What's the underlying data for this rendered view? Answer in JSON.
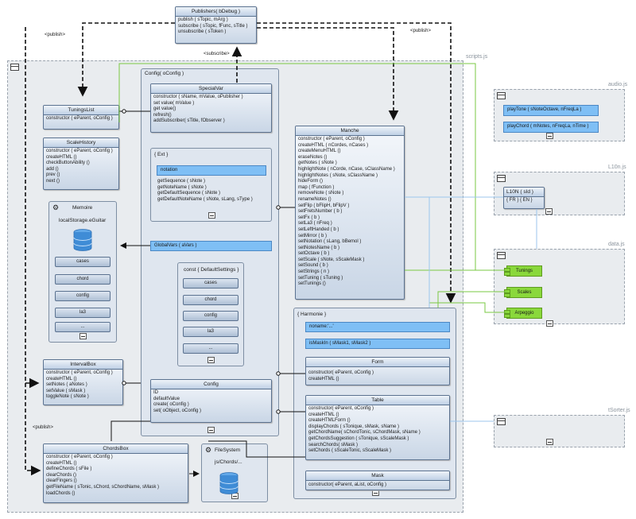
{
  "packages": {
    "scripts": {
      "label": "scripts.js"
    },
    "audio": {
      "label": "audio.js"
    },
    "l10n": {
      "label": "L10n.js"
    },
    "data": {
      "label": "data.js"
    },
    "isorter": {
      "label": "tSorter.js"
    }
  },
  "publishers": {
    "title": "Publishers( bDebug )",
    "methods": [
      "publish ( sTopic, mArg )",
      "subscribe ( sTopic, fFunc, sTitle )",
      "unsubscribe ( sToken )"
    ]
  },
  "connector_labels": {
    "publish_left": "<publish>",
    "subscribe": "<subscribe>",
    "publish_right": "<publish>",
    "publish_bottom": "<publish>"
  },
  "config_frame": {
    "title": "Config( oConfig )"
  },
  "special_var": {
    "title": "SpecialVar",
    "methods": [
      "constructor ( sName, mValue, oPublisher )",
      "set value( mValue )",
      "get value()",
      "refresh()",
      "addSubscriber( sTitle, fObserver )"
    ]
  },
  "ext_frame": {
    "title": "{ Ext }",
    "attribute": "notation",
    "methods": [
      "getSequence ( sNote )",
      "getNoteName ( sNote )",
      "getDefaultSequence ( sNote )",
      "getDefaultNoteName ( sNote, sLang, sType )"
    ]
  },
  "global_vars": {
    "label": "GlobalVars ( aVars )"
  },
  "default_settings": {
    "title": "const { DefaultSettings }",
    "items": [
      "cases",
      "chord",
      "config",
      "la3",
      "..."
    ]
  },
  "config_class": {
    "title": "Config",
    "members": [
      "ID",
      "defaultValue",
      "create( oConfig )",
      "set( oObject, oConfig )"
    ]
  },
  "tunings_list": {
    "title": "TuningsList",
    "methods": [
      "constructor ( eParent, oConfig )"
    ]
  },
  "scale_history": {
    "title": "ScaleHistory",
    "methods": [
      "constructor ( eParent, oConfig )",
      "createHTML ()",
      "checkButtonAbility ()",
      "add ()",
      "prev ()",
      "next ()"
    ]
  },
  "memoire": {
    "title": "Memoire",
    "subtitle": "localStorage.eGuitar",
    "items": [
      "cases",
      "chord",
      "config",
      "la3",
      "..."
    ]
  },
  "interval_box": {
    "title": "IntervalBox",
    "methods": [
      "constructor ( eParent, oConfig )",
      "createHTML ()",
      "setNotes ( aNotes )",
      "setValue ( sMask )",
      "toggleNote ( sNote )"
    ]
  },
  "chords_box": {
    "title": "ChordsBox",
    "methods": [
      "constructor ( eParent, oConfig )",
      "createHTML ()",
      "defineChords ( sFile )",
      "clearChords ()",
      "clearFingers ()",
      "getFileName ( sTonic, sChord, sChordName, sMask )",
      "loadChords ()"
    ]
  },
  "file_system": {
    "title": "FileSystem",
    "subtitle": "js/Chords/..."
  },
  "manche": {
    "title": "Manche",
    "methods": [
      "constructor ( eParent, oConfig )",
      "createHTML ( nCordes, nCases )",
      "createMenuHTML ()",
      "eraseNotes ()",
      "getNotes ( sNote )",
      "highlightNote ( nCorde, nCase, sClassName )",
      "highlightNotes ( sNote, sClassName )",
      "hideForm ()",
      "map ( fFunction )",
      "removeNote ( sNote )",
      "renameNotes ()",
      "setFlip ( bFlipH, bFlipV )",
      "setFretsNumber ( b )",
      "setFx ( b )",
      "setLa3 ( nFreq )",
      "setLeftHanded ( b )",
      "setMirror ( b )",
      "setNotation ( sLang, bBemol )",
      "setNotesName ( b )",
      "setOctave ( b )",
      "setScale ( sNote, sScaleMask )",
      "setSound ( b )",
      "setStrings ( n )",
      "setTuning ( sTuning )",
      "setTunings ()"
    ]
  },
  "harmonie": {
    "title": "{ Harmonie }",
    "attr1": "noname:'...'",
    "attr2": "isMaskIn ( sMask1, sMask2 )"
  },
  "form": {
    "title": "Form",
    "methods": [
      "constructor( eParent, oConfig )",
      "createHTML ()"
    ]
  },
  "table": {
    "title": "Table",
    "methods": [
      "constructor( eParent, oConfig )",
      "createHTML ()",
      "createHTMLForm ()",
      "displayChords ( sTonique, sMask, sName )",
      "getChordName( sChordTonic, sChordMask, sName )",
      "getChordsSuggestion ( sTonique, sScaleMask )",
      "searchChords( sMask )",
      "setChords ( sScaleTonic, sScaleMask )"
    ]
  },
  "mask": {
    "title": "Mask",
    "methods": [
      "constructor( eParent, aList, oConfig )"
    ]
  },
  "audio": {
    "items": [
      "playTone ( sNoteOctave, nFreqLa )",
      "playChord ( mNotes, nFreqLa, nTime )"
    ]
  },
  "l10n": {
    "title": "L10N ( sId )",
    "sub": "{ FR } { EN }"
  },
  "data": {
    "items": [
      "Tunings",
      "Scales",
      "Arpeggio"
    ]
  }
}
